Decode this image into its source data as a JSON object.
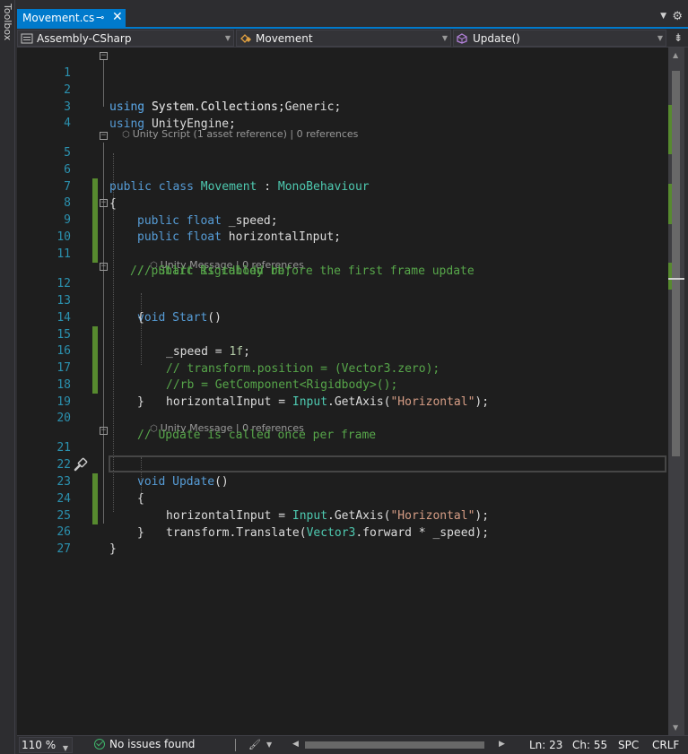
{
  "toolbox": {
    "label": "Toolbox"
  },
  "tab": {
    "title": "Movement.cs",
    "pin_icon": "pin-icon",
    "close_icon": "close-icon"
  },
  "navbar": {
    "project": "Assembly-CSharp",
    "class": "Movement",
    "member": "Update()"
  },
  "editor": {
    "lines": [
      {
        "n": "1"
      },
      {
        "n": "2"
      },
      {
        "n": "3"
      },
      {
        "n": "4"
      },
      {
        "n": "5"
      },
      {
        "n": "6"
      },
      {
        "n": "7"
      },
      {
        "n": "8"
      },
      {
        "n": "9"
      },
      {
        "n": "10"
      },
      {
        "n": "11"
      },
      {
        "n": "12"
      },
      {
        "n": "13"
      },
      {
        "n": "14"
      },
      {
        "n": "15"
      },
      {
        "n": "16"
      },
      {
        "n": "17"
      },
      {
        "n": "18"
      },
      {
        "n": "19"
      },
      {
        "n": "20"
      },
      {
        "n": "21"
      },
      {
        "n": "22"
      },
      {
        "n": "23"
      },
      {
        "n": "24"
      },
      {
        "n": "25"
      },
      {
        "n": "26"
      },
      {
        "n": "27"
      }
    ],
    "code": {
      "l1": [
        "using",
        " System.Collections;"
      ],
      "l2": [
        "using",
        " System.Collections.Generic;"
      ],
      "l3": [
        "using",
        " UnityEngine;"
      ],
      "l5": [
        "public",
        " ",
        "class",
        " ",
        "Movement",
        " : ",
        "MonoBehaviour"
      ],
      "l6": "{",
      "l7": [
        "public",
        " ",
        "float",
        " _speed;"
      ],
      "l8": [
        "public",
        " ",
        "float",
        " horizontalInput;"
      ],
      "l9": "// public Rigidbody rb;",
      "l11": "// Start is called before the first frame update",
      "l12": [
        "void",
        " ",
        "Start",
        "()"
      ],
      "l13": "{",
      "l14": [
        "_speed = ",
        "1f",
        ";"
      ],
      "l15": "// transform.position = (Vector3.zero);",
      "l16": "//rb = GetComponent<Rigidbody>();",
      "l17": [
        "horizontalInput = ",
        "Input",
        ".",
        "GetAxis",
        "(",
        "\"Horizontal\"",
        ");"
      ],
      "l18": "}",
      "l20": "// Update is called once per frame",
      "l21": [
        "void",
        " ",
        "Update",
        "()"
      ],
      "l22": "{",
      "l23": [
        "horizontalInput = ",
        "Input",
        ".",
        "GetAxis",
        "(",
        "\"Horizontal\"",
        ");"
      ],
      "l24": [
        "transform",
        ".",
        "Translate",
        "(",
        "Vector3",
        ".forward * _speed);"
      ],
      "l25": "}",
      "l26": "}"
    },
    "lens": {
      "class_ref": [
        "Unity Script (1 asset reference)",
        "|",
        "0 references"
      ],
      "start_ref": [
        "Unity Message",
        "|",
        "0 references"
      ],
      "update_ref": [
        "Unity Message",
        "|",
        "0 references"
      ]
    },
    "gutter_icon": "brush-icon"
  },
  "statusbar": {
    "zoom": "110 %",
    "issues": "No issues found",
    "line": "Ln: 23",
    "col": "Ch: 55",
    "spacing": "SPC",
    "eol": "CRLF"
  },
  "colors": {
    "accent": "#007acc",
    "keyword": "#569cd6",
    "type": "#4ec9b0",
    "comment": "#57a64a",
    "string": "#d69d85",
    "number": "#b5cea8",
    "change_bar": "#578a2f"
  }
}
